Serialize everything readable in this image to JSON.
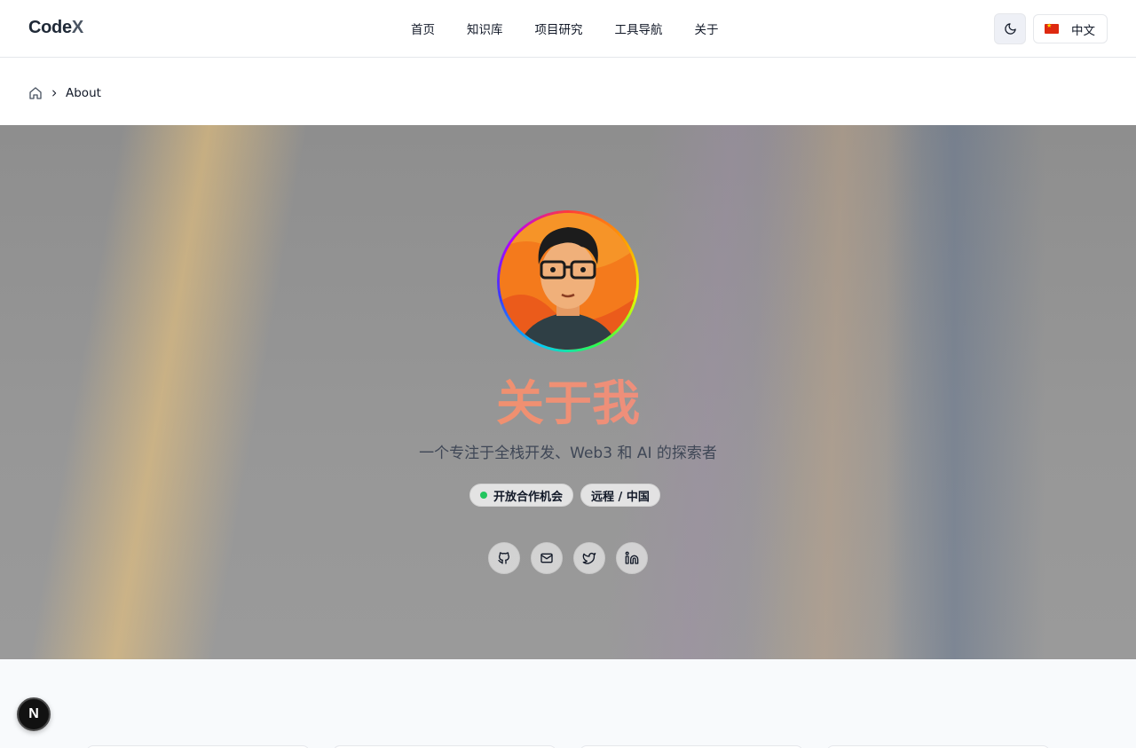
{
  "header": {
    "logo_main": "Code",
    "logo_accent": "X",
    "nav": [
      "首页",
      "知识库",
      "项目研究",
      "工具导航",
      "关于"
    ],
    "theme_icon": "moon-icon",
    "language": "中文",
    "flag_icon": "china-flag-icon"
  },
  "breadcrumb": {
    "home_icon": "home-icon",
    "current": "About"
  },
  "hero": {
    "title": "关于我",
    "subtitle": "一个专注于全栈开发、Web3 和 AI 的探索者",
    "tags": [
      "开放合作机会",
      "远程 / 中国"
    ],
    "status_color": "#22c55e",
    "socials": [
      "github-icon",
      "mail-icon",
      "twitter-icon",
      "linkedin-icon"
    ]
  },
  "dev_badge": "N"
}
